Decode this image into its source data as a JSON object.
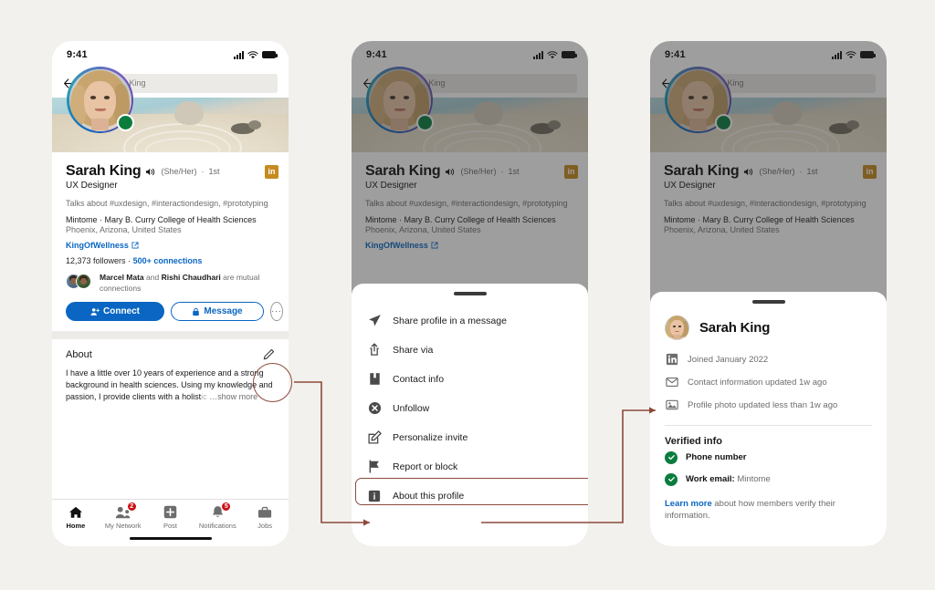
{
  "background_color": "#f2f1ed",
  "accent": {
    "linkedin_blue": "#0a66c2",
    "connector": "#8c4a3b",
    "verified_green": "#0a7d3e",
    "badge_red": "#cc1016",
    "gold": "#c68a1e"
  },
  "status_bar": {
    "time": "9:41"
  },
  "search": {
    "value": "Sarah King",
    "icon": "search-icon",
    "back_icon": "back-arrow-icon"
  },
  "profile": {
    "name": "Sarah King",
    "pronouns": "(She/Her)",
    "degree": "1st",
    "headline": "UX Designer",
    "talks_about": "Talks about #uxdesign, #interactiondesign, #prototyping",
    "company_line": "Mintome · Mary B. Curry College of Health Sciences",
    "location": "Phoenix, Arizona, United States",
    "website": "KingOfWellness",
    "followers": "12,373 followers",
    "separator": "·",
    "connections": "500+ connections",
    "mutual_prefix": "Marcel Mata",
    "mutual_join": "and",
    "mutual_second": "Rishi Chaudhari",
    "mutual_suffix": "are mutual connections",
    "badge_label": "in"
  },
  "actions": {
    "connect": "Connect",
    "message": "Message",
    "more": "···",
    "connect_icon": "person-add-icon",
    "message_icon": "lock-icon",
    "more_icon": "ellipsis-icon"
  },
  "about": {
    "title": "About",
    "edit_icon": "pencil-icon",
    "text": "I have a little over 10 years of experience and a strong background in health sciences. Using my knowledge and passion, I provide clients with a holist",
    "faded_tail": "ic",
    "show_more": "…show more"
  },
  "tabbar": {
    "items": [
      {
        "label": "Home",
        "icon": "home-icon",
        "badge": "",
        "active": true
      },
      {
        "label": "My Network",
        "icon": "people-icon",
        "badge": "2",
        "active": false
      },
      {
        "label": "Post",
        "icon": "plus-square-icon",
        "badge": "",
        "active": false
      },
      {
        "label": "Notifications",
        "icon": "bell-icon",
        "badge": "5",
        "active": false
      },
      {
        "label": "Jobs",
        "icon": "briefcase-icon",
        "badge": "",
        "active": false
      }
    ]
  },
  "action_sheet": {
    "items": [
      {
        "label": "Share profile in a message",
        "icon": "paper-plane-icon",
        "highlighted": false
      },
      {
        "label": "Share via",
        "icon": "share-up-icon",
        "highlighted": false
      },
      {
        "label": "Contact info",
        "icon": "book-icon",
        "highlighted": false
      },
      {
        "label": "Unfollow",
        "icon": "x-circle-icon",
        "highlighted": false
      },
      {
        "label": "Personalize invite",
        "icon": "pencil-square-icon",
        "highlighted": false
      },
      {
        "label": "Report or block",
        "icon": "flag-icon",
        "highlighted": false
      },
      {
        "label": "About this profile",
        "icon": "info-square-icon",
        "highlighted": true
      }
    ]
  },
  "about_profile_sheet": {
    "name": "Sarah King",
    "rows": [
      {
        "label": "Joined January 2022",
        "icon": "linkedin-icon"
      },
      {
        "label": "Contact information updated 1w ago",
        "icon": "envelope-icon"
      },
      {
        "label": "Profile photo updated less than 1w ago",
        "icon": "photo-icon"
      }
    ],
    "verified_title": "Verified info",
    "verified": [
      {
        "label": "Phone number",
        "value": "",
        "icon": "check-circle-icon"
      },
      {
        "label": "Work email:",
        "value": "Mintome",
        "icon": "check-circle-icon"
      }
    ],
    "learn_more_link": "Learn more",
    "learn_more_rest": " about how members verify their information."
  }
}
